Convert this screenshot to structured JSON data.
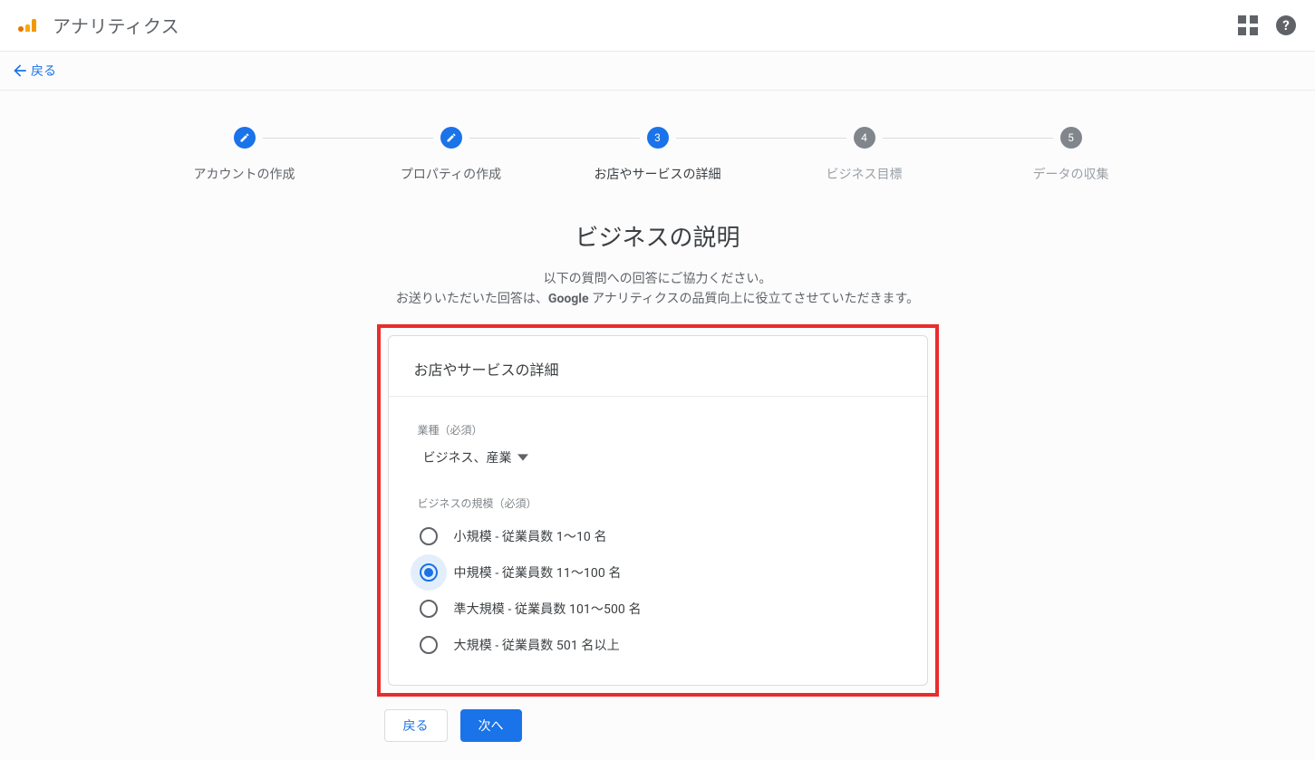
{
  "app": {
    "title": "アナリティクス"
  },
  "backStrip": {
    "label": "戻る"
  },
  "stepper": {
    "steps": [
      {
        "label": "アカウントの作成",
        "state": "done"
      },
      {
        "label": "プロパティの作成",
        "state": "done"
      },
      {
        "label": "お店やサービスの詳細",
        "state": "current",
        "number": "3"
      },
      {
        "label": "ビジネス目標",
        "state": "upcoming",
        "number": "4"
      },
      {
        "label": "データの収集",
        "state": "upcoming",
        "number": "5"
      }
    ]
  },
  "heading": {
    "title": "ビジネスの説明",
    "sub_line1": "以下の質問への回答にご協力ください。",
    "sub_line2_prefix": "お送りいただいた回答は、",
    "sub_line2_bold": "Google",
    "sub_line2_suffix": " アナリティクスの品質向上に役立てさせていただきます。"
  },
  "card": {
    "title": "お店やサービスの詳細",
    "industry": {
      "label": "業種（必須）",
      "value": "ビジネス、産業"
    },
    "size": {
      "label": "ビジネスの規模（必須）",
      "options": [
        {
          "label": "小規模 - 従業員数 1〜10 名",
          "selected": false
        },
        {
          "label": "中規模 - 従業員数 11〜100 名",
          "selected": true
        },
        {
          "label": "準大規模 - 従業員数 101〜500 名",
          "selected": false
        },
        {
          "label": "大規模 - 従業員数 501 名以上",
          "selected": false
        }
      ]
    }
  },
  "footer": {
    "back": "戻る",
    "next": "次へ"
  }
}
